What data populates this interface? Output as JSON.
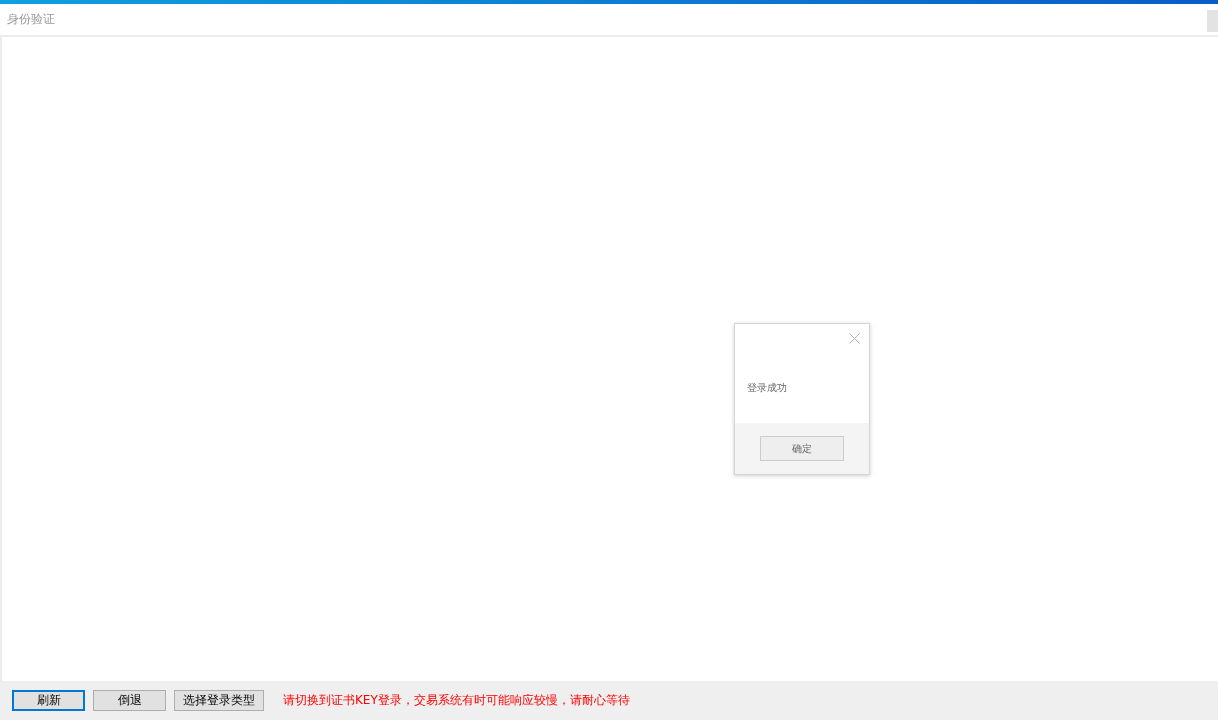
{
  "window": {
    "title": "身份验证"
  },
  "dialog": {
    "message": "登录成功",
    "confirm": "确定"
  },
  "buttons": [
    {
      "label": "刷新",
      "focused": true
    },
    {
      "label": "倒退",
      "focused": false
    },
    {
      "label": "选择登录类型",
      "focused": false
    }
  ],
  "notice": "请切换到证书KEY登录，交易系统有时可能响应较慢，请耐心等待"
}
